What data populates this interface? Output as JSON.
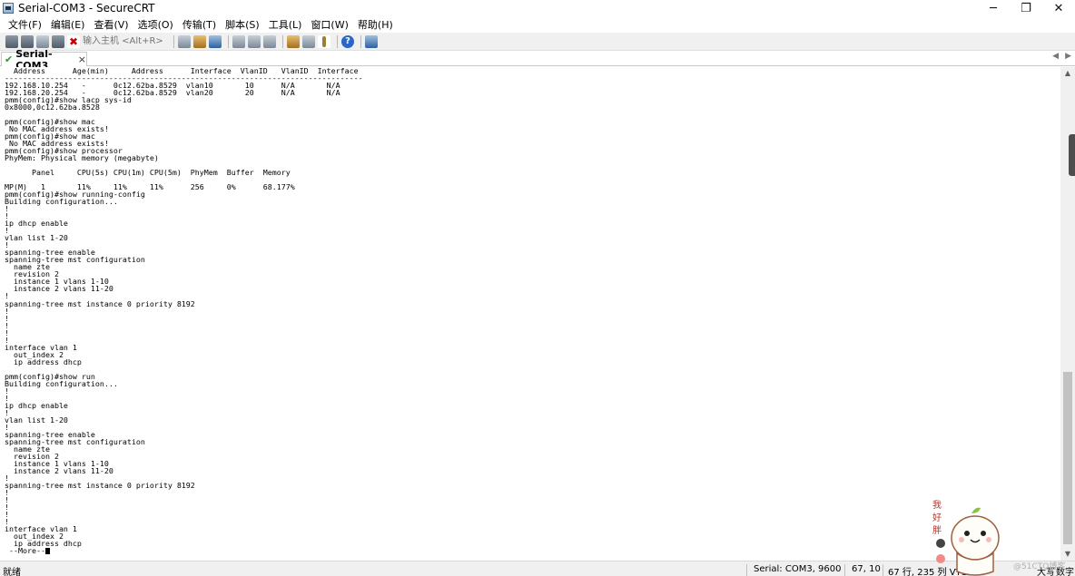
{
  "window": {
    "title": "Serial-COM3 - SecureCRT",
    "minimize": "─",
    "maximize": "❐",
    "close": "✕"
  },
  "menu": [
    "文件(F)",
    "编辑(E)",
    "查看(V)",
    "选项(O)",
    "传输(T)",
    "脚本(S)",
    "工具(L)",
    "窗口(W)",
    "帮助(H)"
  ],
  "toolbar": {
    "quick_connect_placeholder": "输入主机 <Alt+R>",
    "help_glyph": "?",
    "delete_glyph": "✖"
  },
  "tab": {
    "label": "Serial-COM3",
    "close_glyph": "×",
    "check_glyph": "✔",
    "prev_glyph": "◀",
    "next_glyph": "▶"
  },
  "terminal": {
    "lines": [
      "  Address      Age(min)     Address      Interface  VlanID   VlanID  Interface",
      "-------------------------------------------------------------------------------",
      "192.168.10.254   -      0c12.62ba.8529  vlan10       10      N/A       N/A",
      "192.168.20.254   -      0c12.62ba.8529  vlan20       20      N/A       N/A",
      "pmm(config)#show lacp sys-id",
      "0x8000,0c12.62ba.8528",
      "",
      "pmm(config)#show mac",
      " No MAC address exists!",
      "pmm(config)#show mac",
      " No MAC address exists!",
      "pmm(config)#show processor",
      "PhyMem: Physical memory (megabyte)",
      "",
      "      Panel     CPU(5s) CPU(1m) CPU(5m)  PhyMem  Buffer  Memory",
      "",
      "MP(M)   1       11%     11%     11%      256     0%      68.177%",
      "pmm(config)#show running-config",
      "Building configuration...",
      "!",
      "!",
      "ip dhcp enable",
      "!",
      "vlan list 1-20",
      "!",
      "spanning-tree enable",
      "spanning-tree mst configuration",
      "  name zte",
      "  revision 2",
      "  instance 1 vlans 1-10",
      "  instance 2 vlans 11-20",
      "!",
      "spanning-tree mst instance 0 priority 8192",
      "!",
      "!",
      "!",
      "!",
      "!",
      "interface vlan 1",
      "  out_index 2",
      "  ip address dhcp",
      "",
      "pmm(config)#show run",
      "Building configuration...",
      "!",
      "!",
      "ip dhcp enable",
      "!",
      "vlan list 1-20",
      "!",
      "spanning-tree enable",
      "spanning-tree mst configuration",
      "  name zte",
      "  revision 2",
      "  instance 1 vlans 1-10",
      "  instance 2 vlans 11-20",
      "!",
      "spanning-tree mst instance 0 priority 8192",
      "!",
      "!",
      "!",
      "!",
      "!",
      "interface vlan 1",
      "  out_index 2",
      "  ip address dhcp",
      " --More--"
    ]
  },
  "scrollbar": {
    "up_glyph": "▲",
    "down_glyph": "▼",
    "position": 0.93
  },
  "status": {
    "ready": "就绪",
    "connection": "Serial: COM3, 9600",
    "cursor_pos": "67, 10",
    "rows_cols": "67 行, 235 列 VT100",
    "caps": "大写",
    "num": "数字"
  },
  "sticker": {
    "text_chars": [
      "我",
      "好",
      "胖"
    ]
  },
  "watermark": "@51CTO博客",
  "colors": {
    "accent_check": "#2a9a2a",
    "help_blue": "#2a66c8",
    "terminal_bg": "#ffffff",
    "terminal_fg": "#000000"
  }
}
